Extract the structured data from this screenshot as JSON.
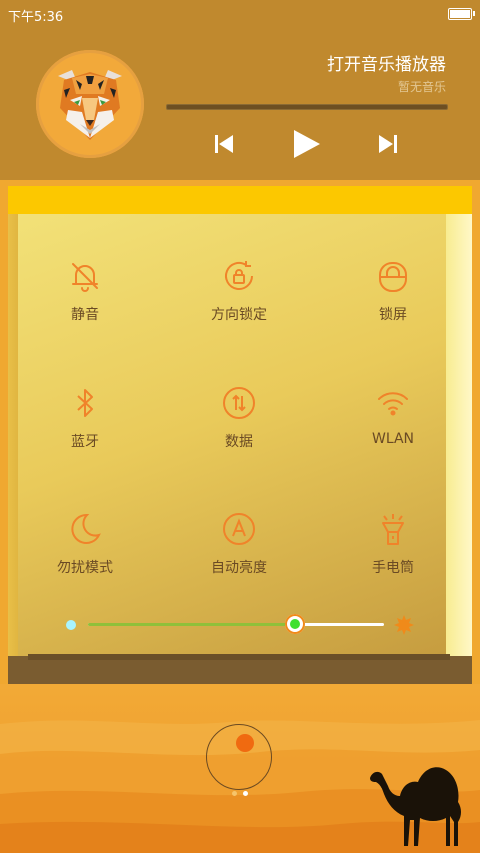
{
  "status": {
    "time": "下午5:36"
  },
  "music": {
    "title": "打开音乐播放器",
    "subtitle": "暂无音乐",
    "progress": 0
  },
  "tiles": [
    {
      "label": "静音",
      "icon": "bell-off-icon"
    },
    {
      "label": "方向锁定",
      "icon": "rotation-lock-icon"
    },
    {
      "label": "锁屏",
      "icon": "lock-icon"
    },
    {
      "label": "蓝牙",
      "icon": "bluetooth-icon"
    },
    {
      "label": "数据",
      "icon": "mobile-data-icon"
    },
    {
      "label": "WLAN",
      "icon": "wifi-icon"
    },
    {
      "label": "勿扰模式",
      "icon": "moon-icon"
    },
    {
      "label": "自动亮度",
      "icon": "auto-brightness-icon"
    },
    {
      "label": "手电筒",
      "icon": "flashlight-icon"
    }
  ],
  "brightness": {
    "level": 0.7
  },
  "pager": {
    "count": 2,
    "active": 1
  },
  "colors": {
    "accent": "#f08a1a",
    "icon": "#f0832a",
    "header": "#c0892e",
    "slider": "#8fc03a"
  }
}
